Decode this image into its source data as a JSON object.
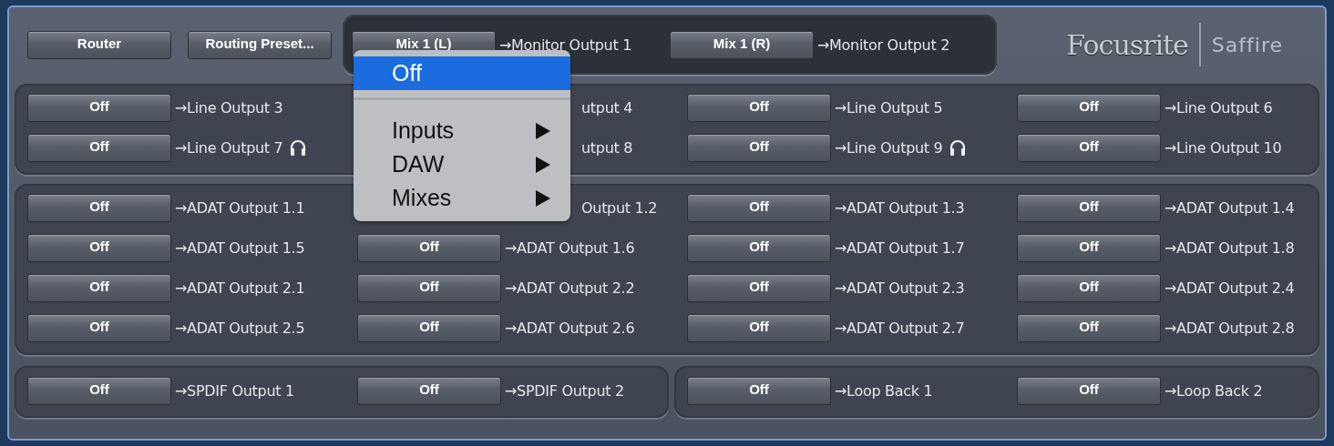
{
  "toolbar": {
    "buttons": [
      "Router",
      "Routing Preset..."
    ]
  },
  "monitor_routes": [
    {
      "button": "Mix 1 (L)",
      "label": "→Monitor Output 1"
    },
    {
      "button": "Mix 1 (R)",
      "label": "→Monitor Output 2"
    }
  ],
  "logo": {
    "brand": "Focusrite",
    "product": "Saffire"
  },
  "sections": [
    {
      "rows": [
        [
          {
            "button": "Off",
            "label": "→Line Output 3",
            "headphones": false
          },
          {
            "label": "utput 4",
            "headphones": false
          },
          {
            "button": "Off",
            "label": "→Line Output 5",
            "headphones": false
          },
          {
            "button": "Off",
            "label": "→Line Output 6",
            "headphones": false
          }
        ],
        [
          {
            "button": "Off",
            "label": "→Line Output 7",
            "headphones": true
          },
          {
            "label": "utput 8",
            "headphones": false
          },
          {
            "button": "Off",
            "label": "→Line Output 9",
            "headphones": true
          },
          {
            "button": "Off",
            "label": "→Line Output 10",
            "headphones": false
          }
        ]
      ]
    },
    {
      "rows": [
        [
          {
            "button": "Off",
            "label": "→ADAT Output 1.1",
            "headphones": false
          },
          {
            "label": "Output 1.2",
            "headphones": false
          },
          {
            "button": "Off",
            "label": "→ADAT Output 1.3",
            "headphones": false
          },
          {
            "button": "Off",
            "label": "→ADAT Output 1.4",
            "headphones": false
          }
        ],
        [
          {
            "button": "Off",
            "label": "→ADAT Output 1.5",
            "headphones": false
          },
          {
            "button": "Off",
            "label": "→ADAT Output 1.6",
            "headphones": false
          },
          {
            "button": "Off",
            "label": "→ADAT Output 1.7",
            "headphones": false
          },
          {
            "button": "Off",
            "label": "→ADAT Output 1.8",
            "headphones": false
          }
        ],
        [
          {
            "button": "Off",
            "label": "→ADAT Output 2.1",
            "headphones": false
          },
          {
            "button": "Off",
            "label": "→ADAT Output 2.2",
            "headphones": false
          },
          {
            "button": "Off",
            "label": "→ADAT Output 2.3",
            "headphones": false
          },
          {
            "button": "Off",
            "label": "→ADAT Output 2.4",
            "headphones": false
          }
        ],
        [
          {
            "button": "Off",
            "label": "→ADAT Output 2.5",
            "headphones": false
          },
          {
            "button": "Off",
            "label": "→ADAT Output 2.6",
            "headphones": false
          },
          {
            "button": "Off",
            "label": "→ADAT Output 2.7",
            "headphones": false
          },
          {
            "button": "Off",
            "label": "→ADAT Output 2.8",
            "headphones": false
          }
        ]
      ]
    }
  ],
  "bottom_groups": [
    [
      {
        "button": "Off",
        "label": "→SPDIF Output 1"
      },
      {
        "button": "Off",
        "label": "→SPDIF Output 2"
      }
    ],
    [
      {
        "button": "Off",
        "label": "→Loop Back 1"
      },
      {
        "button": "Off",
        "label": "→Loop Back 2"
      }
    ]
  ],
  "menu": {
    "items": [
      {
        "kind": "item",
        "label": "Off",
        "selected": true,
        "submenu": false
      },
      {
        "kind": "separator"
      },
      {
        "kind": "item",
        "label": "Inputs",
        "selected": false,
        "submenu": true
      },
      {
        "kind": "item",
        "label": "DAW",
        "selected": false,
        "submenu": true
      },
      {
        "kind": "item",
        "label": "Mixes",
        "selected": false,
        "submenu": true
      }
    ]
  }
}
